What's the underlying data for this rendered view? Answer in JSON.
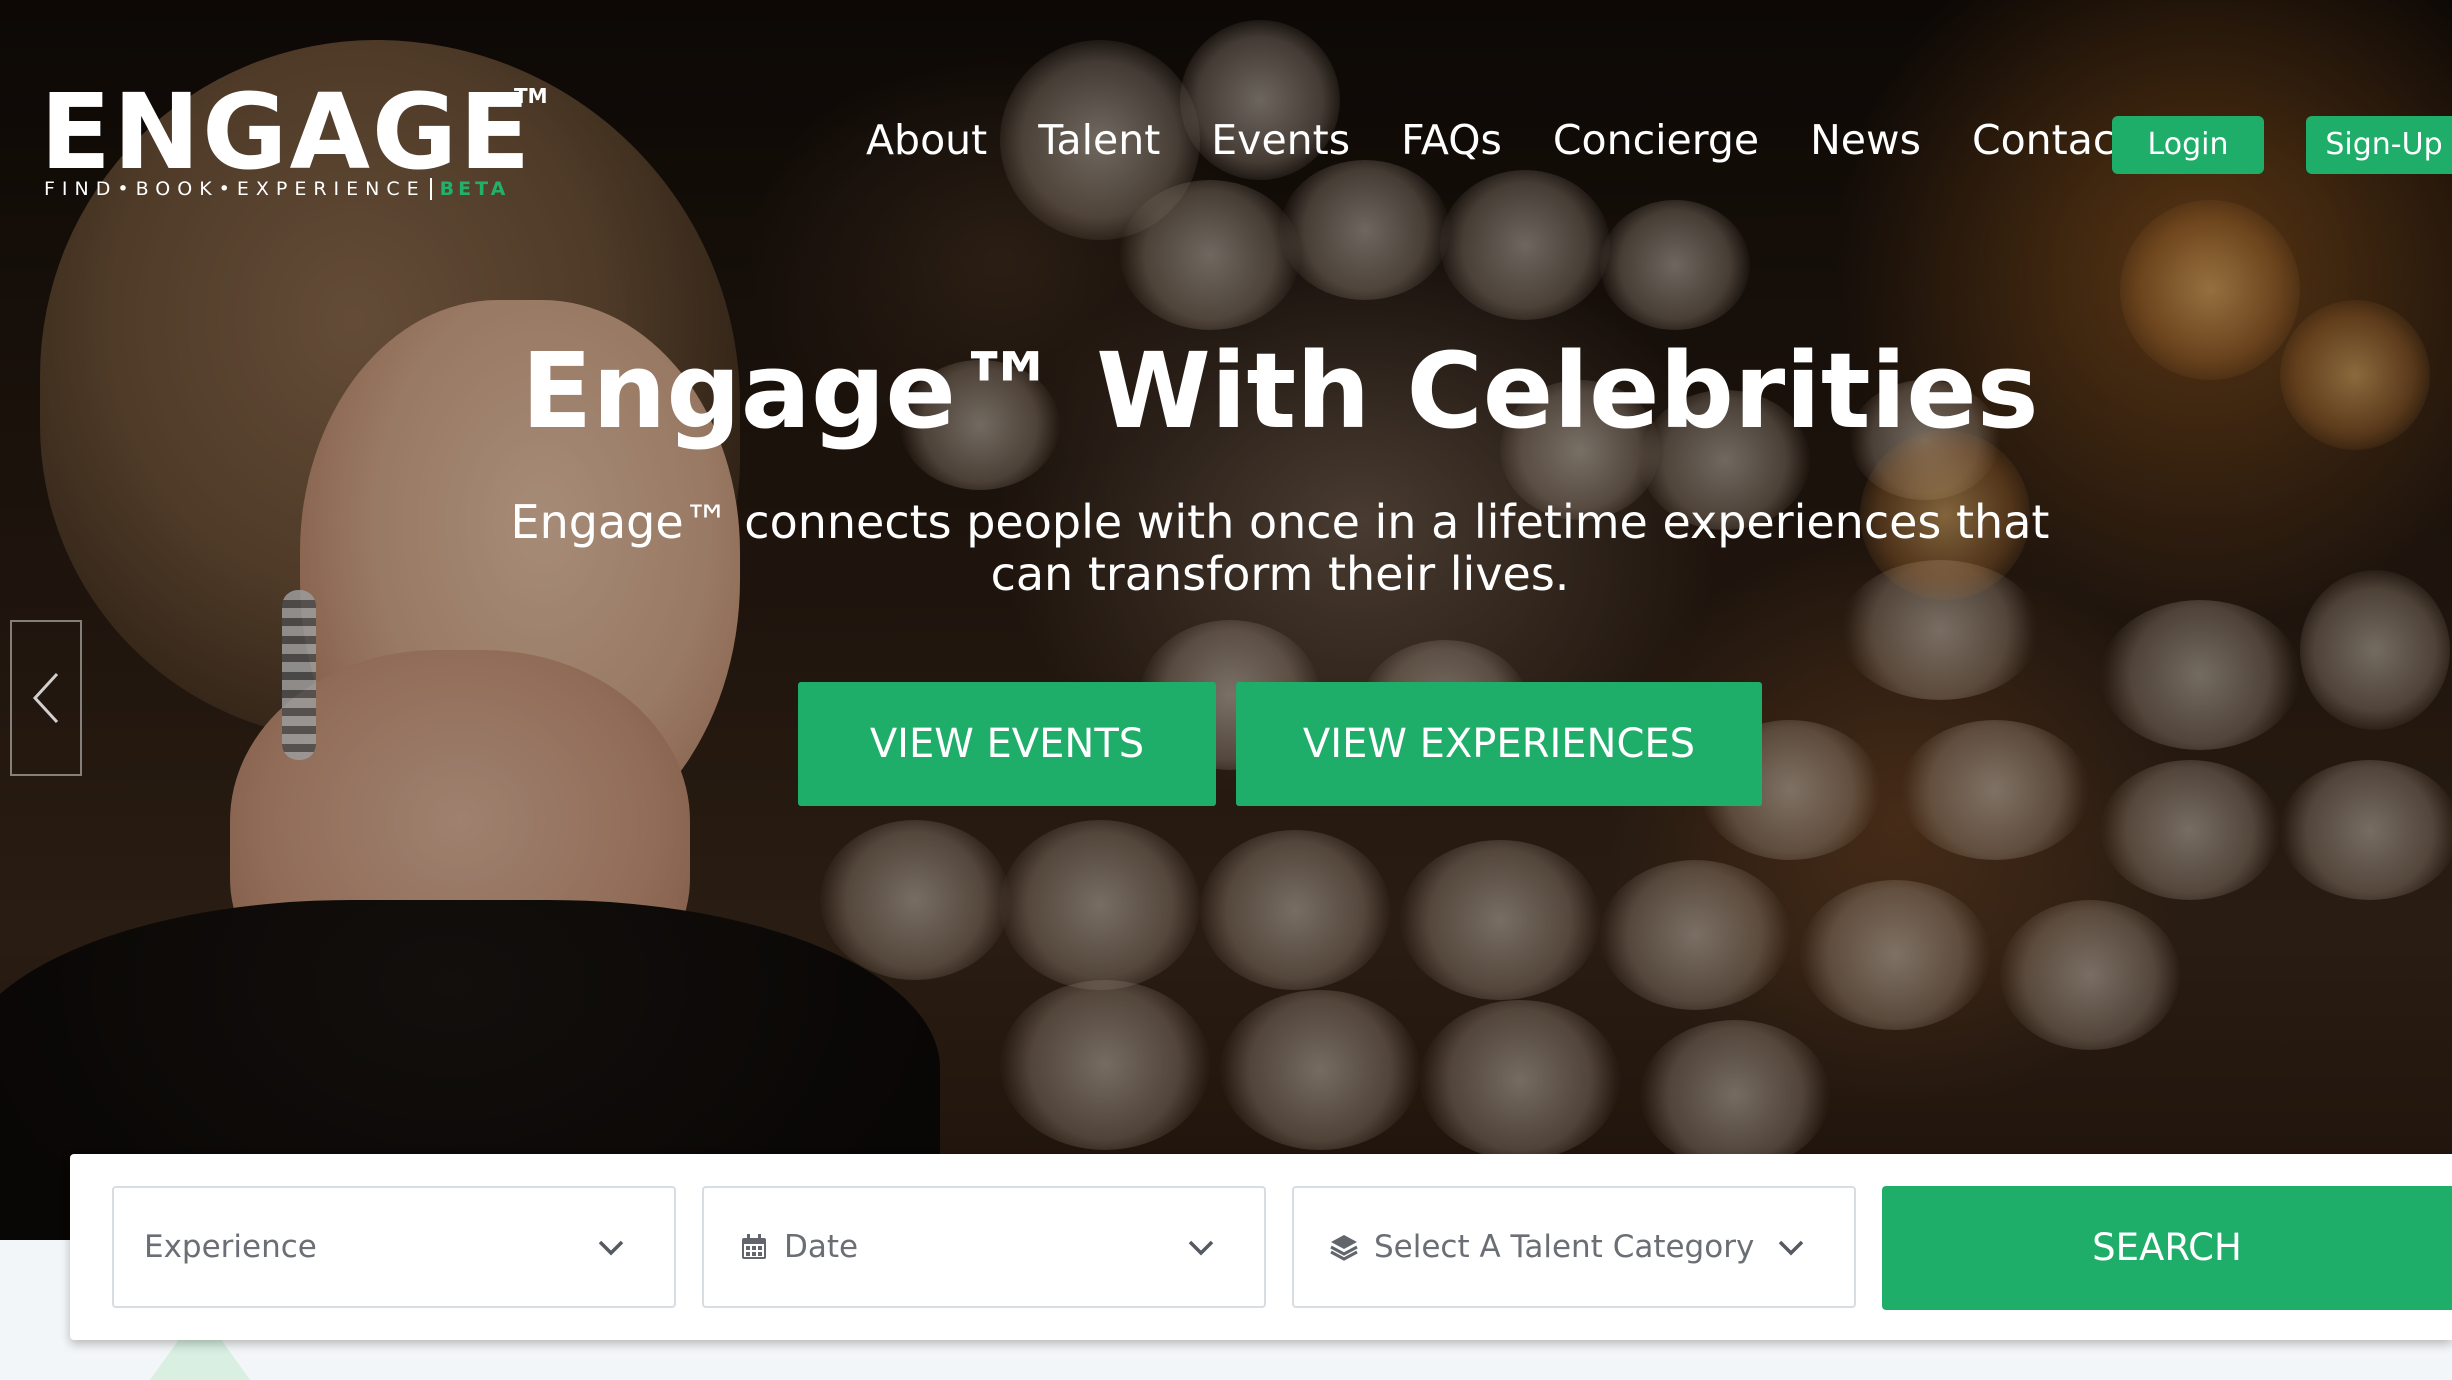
{
  "brand": {
    "name": "ENGAGE",
    "trademark": "TM",
    "tagline": "FIND•BOOK•EXPERIENCE",
    "badge": "BETA",
    "accent_color": "#1fae69"
  },
  "nav": {
    "links": [
      "About",
      "Talent",
      "Events",
      "FAQs",
      "Concierge",
      "News",
      "Contact"
    ],
    "login_label": "Login",
    "signup_label": "Sign-Up"
  },
  "hero": {
    "title": "Engage™ With Celebrities",
    "subtitle": "Engage™ connects people with once in a lifetime experiences that can transform their lives.",
    "cta_events": "VIEW EVENTS",
    "cta_experiences": "VIEW EXPERIENCES",
    "prev_icon": "chevron-left-icon"
  },
  "search": {
    "experience_label": "Experience",
    "date_label": "Date",
    "category_label": "Select A Talent Category",
    "button_label": "SEARCH",
    "icons": {
      "date": "calendar-icon",
      "category": "layers-icon",
      "dropdown": "chevron-down-icon"
    }
  }
}
